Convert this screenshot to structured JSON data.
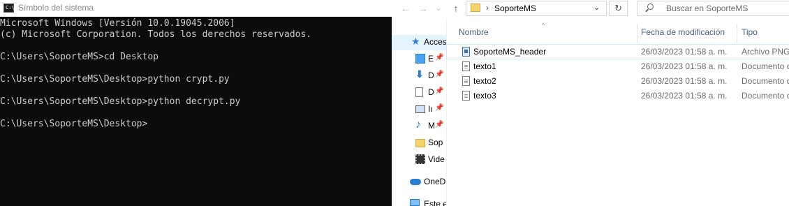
{
  "cmd": {
    "title": "Símbolo del sistema",
    "icon": "cmd-icon",
    "icon_text": "C:\\",
    "lines": [
      "Microsoft Windows [Versión 10.0.19045.2006]",
      "(c) Microsoft Corporation. Todos los derechos reservados.",
      "",
      "C:\\Users\\SoporteMS>cd Desktop",
      "",
      "C:\\Users\\SoporteMS\\Desktop>python crypt.py",
      "",
      "C:\\Users\\SoporteMS\\Desktop>python decrypt.py",
      "",
      "C:\\Users\\SoporteMS\\Desktop>"
    ]
  },
  "explorer": {
    "nav": {
      "back": "←",
      "forward": "→",
      "recent": "⌄",
      "up": "↑"
    },
    "address": {
      "separator": "›",
      "path": "SoporteMS",
      "dropdown": "⌄",
      "refresh": "↻"
    },
    "search": {
      "placeholder": "Buscar en SoporteMS"
    },
    "sidebar": [
      {
        "label": "Acces",
        "icon": "star-icon"
      },
      {
        "label": "E",
        "icon": "desktop-icon",
        "pinned": "📌"
      },
      {
        "label": "D",
        "icon": "download-icon",
        "pinned": "📌"
      },
      {
        "label": "D",
        "icon": "document-icon",
        "pinned": "📌"
      },
      {
        "label": "Iı",
        "icon": "pictures-icon",
        "pinned": "📌"
      },
      {
        "label": "M",
        "icon": "music-icon",
        "pinned": "📌"
      },
      {
        "label": "Sop",
        "icon": "folder-icon"
      },
      {
        "label": "Vide",
        "icon": "video-icon"
      },
      {
        "label": "OneD",
        "icon": "onedrive-icon"
      },
      {
        "label": "Este e",
        "icon": "computer-icon"
      }
    ],
    "columns": {
      "name": "Nombre",
      "date": "Fecha de modificación",
      "type": "Tipo"
    },
    "files": [
      {
        "name": "SoporteMS_header",
        "date": "26/03/2023 01:58 a. m.",
        "type": "Archivo PNG",
        "icon": "png-file-icon"
      },
      {
        "name": "texto1",
        "date": "26/03/2023 01:58 a. m.",
        "type": "Documento de texto",
        "icon": "text-file-icon"
      },
      {
        "name": "texto2",
        "date": "26/03/2023 01:58 a. m.",
        "type": "Documento de texto",
        "icon": "text-file-icon"
      },
      {
        "name": "texto3",
        "date": "26/03/2023 01:58 a. m.",
        "type": "Documento de texto",
        "icon": "text-file-icon"
      }
    ]
  }
}
